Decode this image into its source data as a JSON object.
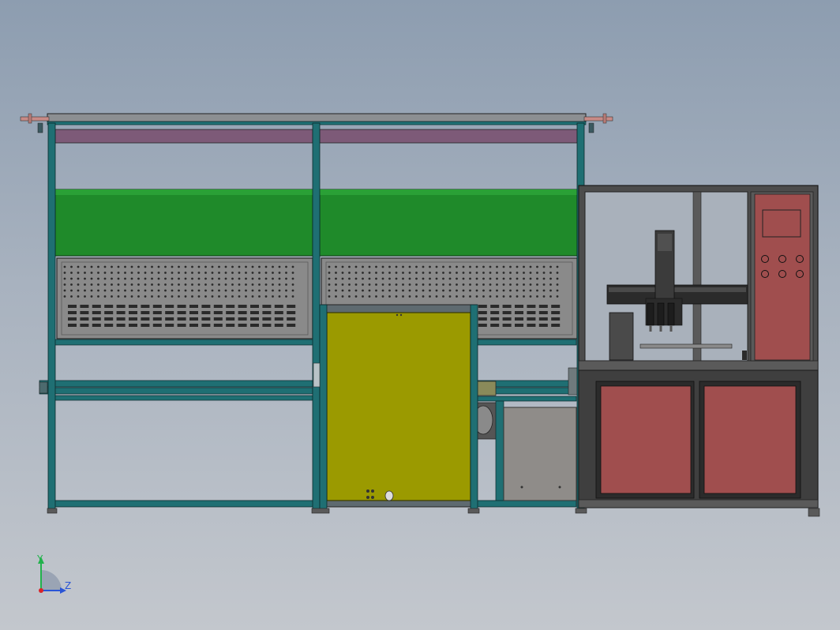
{
  "viewport": {
    "background_top": "#8d9db0",
    "background_bottom": "#c3c7cd"
  },
  "colors": {
    "frame_profile": "#1f6f73",
    "frame_edge": "#0b2a2c",
    "top_beam": "#8c8f92",
    "purple_band": "#7d5a78",
    "green_panel": "#1f8a2a",
    "perforated_panel": "#8a8a8a",
    "yellow_door": "#9b9a00",
    "grey_cabinet": "#8f8c89",
    "red_panel": "#a04e4e",
    "enclosure_frame": "#3a3a3a",
    "glass": "#a9b1bb"
  },
  "machine": {
    "sections": [
      {
        "name": "left-bay"
      },
      {
        "name": "middle-bay"
      },
      {
        "name": "robot-enclosure"
      }
    ],
    "control_panel": {
      "screen": "hmi-screen",
      "buttons_count": 6
    }
  },
  "triad": {
    "y_label": "Y",
    "z_label": "Z"
  }
}
